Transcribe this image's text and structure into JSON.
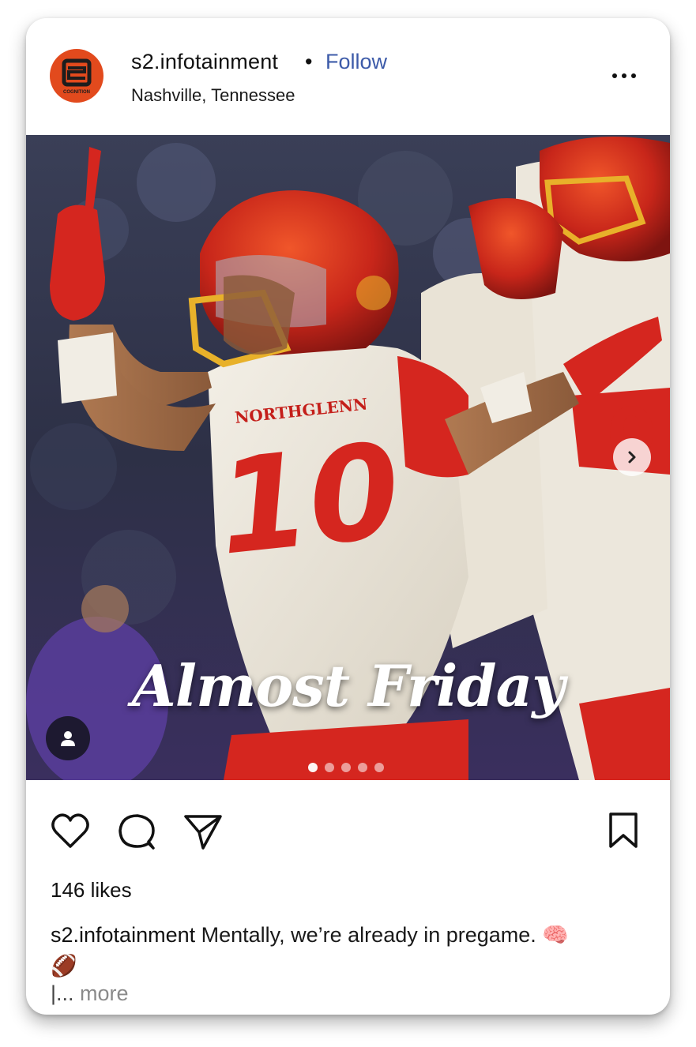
{
  "post": {
    "username": "s2.infotainment",
    "separator": "•",
    "follow_label": "Follow",
    "location": "Nashville, Tennessee",
    "avatar_text": "S2",
    "avatar_subtext": "COGNITION",
    "more_options_icon": "more-horizontal-icon"
  },
  "photo": {
    "overlay_text": "Almost Friday",
    "jersey_text": "NORTHGLENN",
    "jersey_number": "10",
    "carousel_total": 5,
    "carousel_active_index": 0
  },
  "actions": {
    "like_icon": "heart-icon",
    "comment_icon": "comment-icon",
    "share_icon": "send-icon",
    "save_icon": "bookmark-icon"
  },
  "engagement": {
    "likes_text": "146 likes"
  },
  "caption": {
    "username": "s2.infotainment",
    "text": " Mentally, we’re already in pregame. 🧠",
    "second_line": "🏈",
    "truncation_prefix": "|... ",
    "more_label": "more"
  },
  "colors": {
    "follow_blue": "#3d5ba9",
    "brand_orange": "#e24a1d",
    "jersey_red": "#d5261f",
    "helmet_gold": "#e8b12a"
  }
}
